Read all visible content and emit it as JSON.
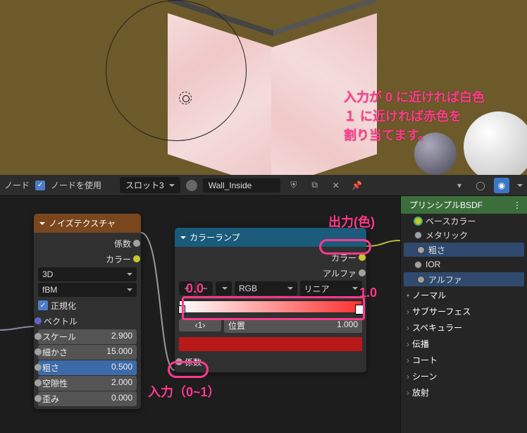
{
  "viewport": {
    "annotation_line1": "入力が 0 に近ければ白色",
    "annotation_line2": "１ に近ければ赤色を",
    "annotation_line3": "割り当てます。"
  },
  "header": {
    "label_node": "ノード",
    "use_nodes": "ノードを使用",
    "slot": "スロット3",
    "material_name": "Wall_Inside"
  },
  "noise_node": {
    "title": "ノイズテクスチャ",
    "out_fac": "係数",
    "out_color": "カラー",
    "dim": "3D",
    "type": "fBM",
    "normalize": "正規化",
    "in_vector": "ベクトル",
    "scale_label": "スケール",
    "scale_val": "2.900",
    "detail_label": "細かさ",
    "detail_val": "15.000",
    "rough_label": "粗さ",
    "rough_val": "0.500",
    "lacun_label": "空隙性",
    "lacun_val": "2.000",
    "distort_label": "歪み",
    "distort_val": "0.000"
  },
  "ramp_node": {
    "title": "カラーランプ",
    "out_color": "カラー",
    "out_alpha": "アルファ",
    "interp": "RGB",
    "ease": "リニア",
    "stop_index": "1",
    "pos_label": "位置",
    "pos_val": "1.000",
    "in_fac": "係数"
  },
  "bsdf": {
    "title": "プリンシプルBSDF",
    "base_color": "ベースカラー",
    "metallic": "メタリック",
    "roughness": "粗さ",
    "ior": "IOR",
    "alpha": "アルファ",
    "normal": "ノーマル",
    "subsurface": "サブサーフェス",
    "specular": "スペキュラー",
    "transmission": "伝播",
    "coat": "コート",
    "sheen": "シーン",
    "emission": "放射"
  },
  "annotations": {
    "output_color": "出力(色)",
    "zero": "0.0",
    "one": "1.0",
    "input_range": "入力（0~1）"
  },
  "chart_data": {
    "type": "color-ramp",
    "stops": [
      {
        "position": 0.0,
        "color": "#ffffff"
      },
      {
        "position": 1.0,
        "color": "#ff2020"
      }
    ],
    "selected_stop": {
      "index": 1,
      "position": 1.0,
      "color": "#b81818"
    },
    "interpolation": "RGB",
    "easing": "リニア",
    "input_domain": [
      0,
      1
    ]
  }
}
